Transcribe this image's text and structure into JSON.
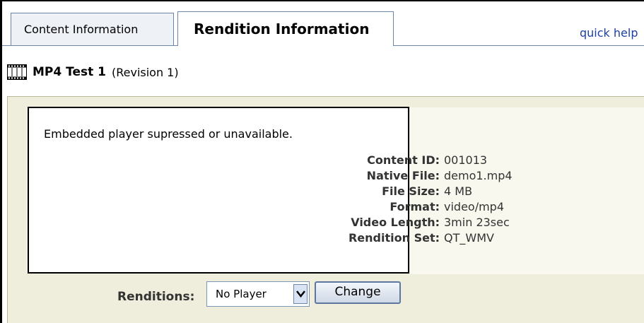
{
  "tabs": {
    "content_label": "Content Information",
    "rendition_label": "Rendition Information"
  },
  "quick_help_label": "quick help",
  "item": {
    "icon": "film-icon",
    "title": "MP4 Test 1",
    "revision": "(Revision 1)"
  },
  "player": {
    "message": "Embedded player supressed or unavailable."
  },
  "info": {
    "content_id_label": "Content ID:",
    "content_id": "001013",
    "native_file_label": "Native File:",
    "native_file": "demo1.mp4",
    "file_size_label": "File Size:",
    "file_size": "4 MB",
    "format_label": "Format:",
    "format": "video/mp4",
    "video_length_label": "Video Length:",
    "video_length": "3min 23sec",
    "rendition_set_label": "Rendition Set:",
    "rendition_set": "QT_WMV"
  },
  "renditions": {
    "label": "Renditions:",
    "selected": "No Player",
    "change_label": "Change"
  },
  "colors": {
    "panel_bg": "#efeedd",
    "link": "#1a3fa6",
    "tab_border": "#6b86a8"
  }
}
